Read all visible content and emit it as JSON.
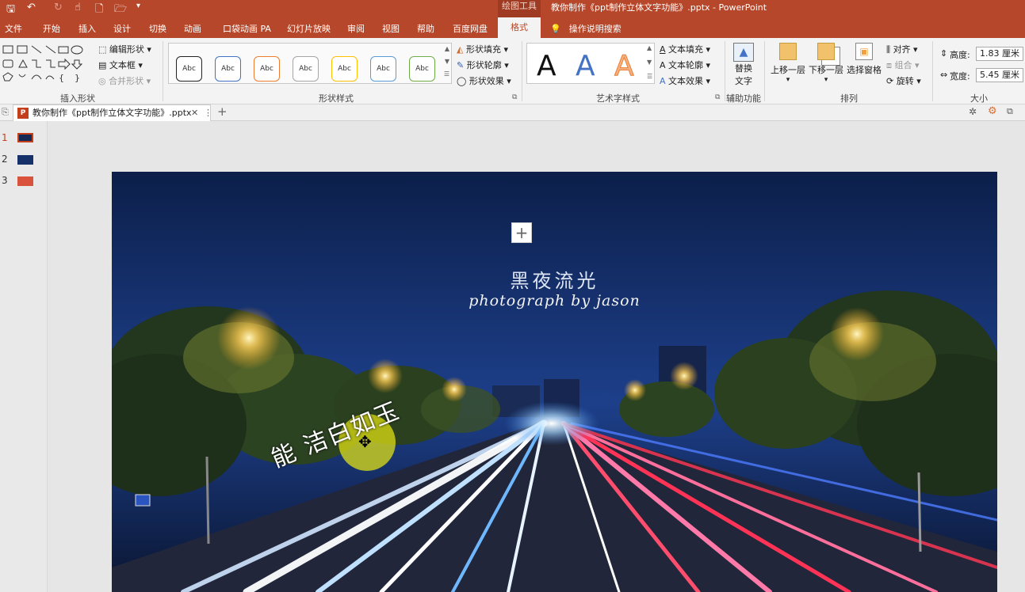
{
  "titlebar": {
    "context_tool": "绘图工具",
    "doc_title": "教你制作《ppt制作立体文字功能》.pptx  -  PowerPoint"
  },
  "tabs": [
    "文件",
    "开始",
    "插入",
    "设计",
    "切换",
    "动画",
    "口袋动画 PA",
    "幻灯片放映",
    "审阅",
    "视图",
    "帮助",
    "百度网盘"
  ],
  "active_tab": "格式",
  "tell_me": "操作说明搜索",
  "ribbon": {
    "insert_shapes": {
      "label": "插入形状",
      "edit_shape": "编辑形状",
      "text_box": "文本框",
      "merge_shapes": "合并形状"
    },
    "shape_styles": {
      "label": "形状样式",
      "sample": "Abc",
      "fill": "形状填充",
      "outline": "形状轮廓",
      "effects": "形状效果"
    },
    "wordart_styles": {
      "label": "艺术字样式",
      "sample": "A",
      "fill": "文本填充",
      "outline": "文本轮廓",
      "effects": "文本效果"
    },
    "accessibility": {
      "label": "辅助功能",
      "alt_text_line1": "替换",
      "alt_text_line2": "文字"
    },
    "arrange": {
      "label": "排列",
      "bring_forward": "上移一层",
      "send_backward": "下移一层",
      "selection_pane": "选择窗格",
      "align": "对齐",
      "group": "组合",
      "rotate": "旋转"
    },
    "size": {
      "label": "大小",
      "height_label": "高度:",
      "height_value": "1.83 厘米",
      "width_label": "宽度:",
      "width_value": "5.45 厘米"
    }
  },
  "file_tab": "教你制作《ppt制作立体文字功能》.pptx",
  "thumbnails": [
    "1",
    "2",
    "3"
  ],
  "slide": {
    "title": "黑夜流光",
    "subtitle": "photograph by jason",
    "curved_text": "能 洁白如玉"
  },
  "colors": {
    "accent": "#b7472a",
    "ribbon_bg": "#f3f3f3"
  }
}
